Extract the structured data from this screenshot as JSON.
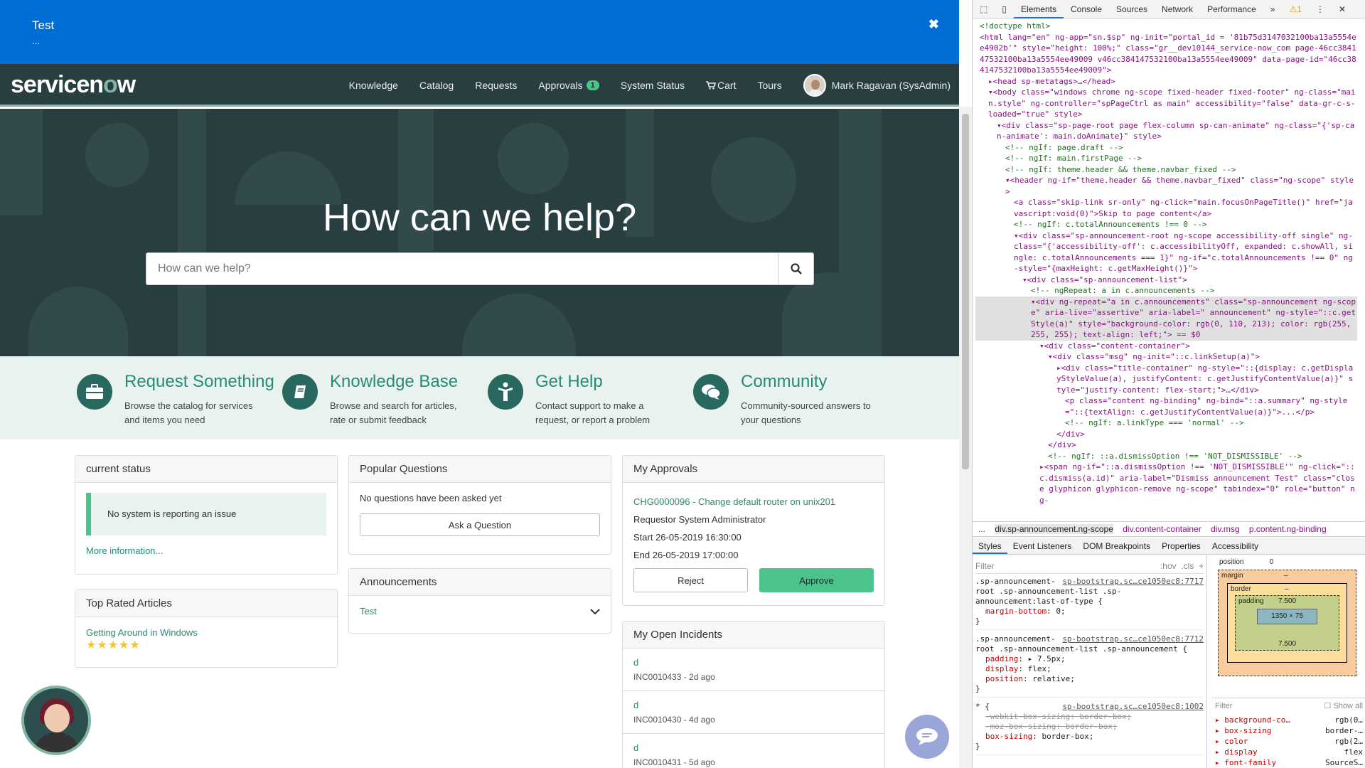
{
  "announcement": {
    "title": "Test",
    "summary": "...",
    "close_glyph": "✖"
  },
  "navbar": {
    "logo_pre": "servicen",
    "logo_o": "o",
    "logo_post": "w",
    "items": [
      "Knowledge",
      "Catalog",
      "Requests",
      "Approvals",
      "System Status",
      "Cart",
      "Tours"
    ],
    "approvals_count": "1",
    "user": "Mark Ragavan (SysAdmin)"
  },
  "hero": {
    "title": "How can we help?",
    "search_placeholder": "How can we help?"
  },
  "features": [
    {
      "title": "Request Something",
      "desc": "Browse the catalog for services and items you need",
      "icon": "briefcase-icon"
    },
    {
      "title": "Knowledge Base",
      "desc": "Browse and search for articles, rate or submit feedback",
      "icon": "book-icon"
    },
    {
      "title": "Get Help",
      "desc": "Contact support to make a request, or report a problem",
      "icon": "person-icon"
    },
    {
      "title": "Community",
      "desc": "Community-sourced answers to your questions",
      "icon": "chat-bubbles-icon"
    }
  ],
  "current_status": {
    "title": "current status",
    "message": "No system is reporting an issue",
    "more": "More information..."
  },
  "top_rated": {
    "title": "Top Rated Articles",
    "article": "Getting Around in Windows",
    "stars": "★★★★★"
  },
  "popular_questions": {
    "title": "Popular Questions",
    "empty": "No questions have been asked yet",
    "ask_button": "Ask a Question"
  },
  "announcements": {
    "title": "Announcements",
    "item": "Test"
  },
  "approvals": {
    "title": "My Approvals",
    "change_link": "CHG0000096 - Change default router on unix201",
    "requestor": "Requestor System Administrator",
    "start": "Start 26-05-2019 16:30:00",
    "end": "End 26-05-2019 17:00:00",
    "reject": "Reject",
    "approve": "Approve"
  },
  "incidents": {
    "title": "My Open Incidents",
    "rows": [
      {
        "short": "d",
        "number": "INC0010433 - 2d ago"
      },
      {
        "short": "d",
        "number": "INC0010430 - 4d ago"
      },
      {
        "short": "d",
        "number": "INC0010431 - 5d ago"
      }
    ]
  },
  "colors": {
    "announcement_bg": "#006ed5",
    "navbar_bg": "#293e40",
    "accent": "#278b76",
    "approve": "#4bc48b"
  },
  "devtools": {
    "tabs": [
      "Elements",
      "Console",
      "Sources",
      "Network",
      "Performance",
      "»"
    ],
    "warning_count": "1",
    "dom_lines": [
      {
        "t": "<!doctype html>",
        "c": "cm",
        "i": 0
      },
      {
        "t": "<html lang=\"en\" ng-app=\"sn.$sp\" ng-init=\"portal_id = '81b75d3147032100ba13a5554ee4902b'\" style=\"height: 100%;\" class=\"gr__dev10144_service-now_com page-46cc384147532100ba13a5554ee49009 v46cc384147532100ba13a5554ee49009\" data-page-id=\"46cc384147532100ba13a5554ee49009\">",
        "c": "tag",
        "i": 0
      },
      {
        "t": "▸<head sp-metatags>…</head>",
        "c": "tag",
        "i": 1
      },
      {
        "t": "▾<body class=\"windows chrome ng-scope fixed-header fixed-footer\" ng-class=\"main.style\" ng-controller=\"spPageCtrl as main\" accessibility=\"false\" data-gr-c-s-loaded=\"true\" style>",
        "c": "tag",
        "i": 1
      },
      {
        "t": "▾<div class=\"sp-page-root page flex-column sp-can-animate\" ng-class=\"{'sp-can-animate': main.doAnimate}\" style>",
        "c": "tag",
        "i": 2
      },
      {
        "t": "<!-- ngIf: page.draft -->",
        "c": "cm",
        "i": 3
      },
      {
        "t": "<!-- ngIf: main.firstPage -->",
        "c": "cm",
        "i": 3
      },
      {
        "t": "<!-- ngIf: theme.header && theme.navbar_fixed -->",
        "c": "cm",
        "i": 3
      },
      {
        "t": "▾<header ng-if=\"theme.header && theme.navbar_fixed\" class=\"ng-scope\" style>",
        "c": "tag",
        "i": 3
      },
      {
        "t": "<a class=\"skip-link sr-only\" ng-click=\"main.focusOnPageTitle()\" href=\"javascript:void(0)\">Skip to page content</a>",
        "c": "tag",
        "i": 4
      },
      {
        "t": "<!-- ngIf: c.totalAnnouncements !== 0 -->",
        "c": "cm",
        "i": 4
      },
      {
        "t": "▾<div class=\"sp-announcement-root ng-scope accessibility-off single\" ng-class=\"{'accessibility-off': c.accessibilityOff, expanded: c.showAll, single: c.totalAnnouncements === 1}\" ng-if=\"c.totalAnnouncements !== 0\" ng-style=\"{maxHeight: c.getMaxHeight()}\">",
        "c": "tag",
        "i": 4
      },
      {
        "t": "▾<div class=\"sp-announcement-list\">",
        "c": "tag",
        "i": 5
      },
      {
        "t": "<!-- ngRepeat: a in c.announcements -->",
        "c": "cm",
        "i": 6
      },
      {
        "t": "▾<div ng-repeat=\"a in c.announcements\" class=\"sp-announcement ng-scope\" aria-live=\"assertive\" aria-label=\" announcement\" ng-style=\"::c.getStyle(a)\" style=\"background-color: rgb(0, 110, 213); color: rgb(255, 255, 255); text-align: left;\"> == $0",
        "c": "tag",
        "i": 6,
        "sel": true
      },
      {
        "t": "▾<div class=\"content-container\">",
        "c": "tag",
        "i": 7
      },
      {
        "t": "▾<div class=\"msg\" ng-init=\"::c.linkSetup(a)\">",
        "c": "tag",
        "i": 8
      },
      {
        "t": "▸<div class=\"title-container\" ng-style=\"::{display: c.getDisplayStyleValue(a), justifyContent: c.getJustifyContentValue(a)}\" style=\"justify-content: flex-start;\">…</div>",
        "c": "tag",
        "i": 9
      },
      {
        "t": "<p class=\"content ng-binding\" ng-bind=\"::a.summary\" ng-style=\"::{textAlign: c.getJustifyContentValue(a)}\">...</p>",
        "c": "tag",
        "i": 10
      },
      {
        "t": "<!-- ngIf: a.linkType === 'normal' -->",
        "c": "cm",
        "i": 10
      },
      {
        "t": "</div>",
        "c": "tag",
        "i": 9
      },
      {
        "t": "</div>",
        "c": "tag",
        "i": 8
      },
      {
        "t": "<!-- ngIf: ::a.dismissOption !== 'NOT_DISMISSIBLE' -->",
        "c": "cm",
        "i": 8
      },
      {
        "t": "▸<span ng-if=\"::a.dismissOption !== 'NOT_DISMISSIBLE'\" ng-click=\"::c.dismiss(a.id)\" aria-label=\"Dismiss announcement Test\" class=\"close glyphicon glyphicon-remove ng-scope\" tabindex=\"0\" role=\"button\" ng-",
        "c": "tag",
        "i": 7
      }
    ],
    "breadcrumbs": [
      "...",
      "div.sp-announcement.ng-scope",
      "div.content-container",
      "div.msg",
      "p.content.ng-binding"
    ],
    "subtabs": [
      "Styles",
      "Event Listeners",
      "DOM Breakpoints",
      "Properties",
      "Accessibility"
    ],
    "filter_placeholder": "Filter",
    "hov": ":hov",
    "cls": ".cls",
    "plus": "+",
    "rules": [
      {
        "sel": ".sp-announcement-root .sp-announcement-list .sp-announcement:last-of-type {",
        "src": "sp-bootstrap.sc…ce1050ec8:7717",
        "props": [
          {
            "n": "margin-bottom",
            "v": "0;",
            "s": false
          }
        ]
      },
      {
        "sel": ".sp-announcement-root .sp-announcement-list .sp-announcement {",
        "src": "sp-bootstrap.sc…ce1050ec8:7712",
        "props": [
          {
            "n": "padding",
            "v": "▸ 7.5px;",
            "s": false
          },
          {
            "n": "display",
            "v": "flex;",
            "s": false
          },
          {
            "n": "position",
            "v": "relative;",
            "s": false
          }
        ]
      },
      {
        "sel": "* {",
        "src": "sp-bootstrap.sc…ce1050ec8:1002",
        "props": [
          {
            "n": "-webkit-box-sizing",
            "v": "border-box;",
            "s": true
          },
          {
            "n": "-moz-box-sizing",
            "v": "border-box;",
            "s": true
          },
          {
            "n": "box-sizing",
            "v": "border-box;",
            "s": false
          }
        ]
      }
    ],
    "box": {
      "position_label": "position",
      "position": "0",
      "margin_label": "margin",
      "margin": "–",
      "border_label": "border",
      "border": "–",
      "padding_label": "padding",
      "padding": "7.500",
      "content": "1350 × 75",
      "dash": "–"
    },
    "computed_filter": "Filter",
    "show_all": "Show all",
    "computed": [
      {
        "n": "background-co…",
        "v": "rgb(0…"
      },
      {
        "n": "box-sizing",
        "v": "border-…"
      },
      {
        "n": "color",
        "v": "rgb(2…"
      },
      {
        "n": "display",
        "v": "flex"
      },
      {
        "n": "font-family",
        "v": "SourceS…"
      }
    ]
  }
}
